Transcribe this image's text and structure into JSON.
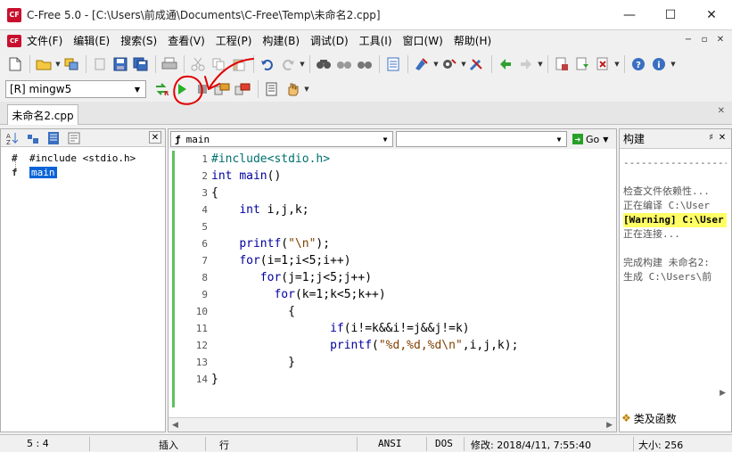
{
  "window": {
    "title": "C-Free 5.0 - [C:\\Users\\前成通\\Documents\\C-Free\\Temp\\未命名2.cpp]",
    "app_icon_text": "CF",
    "minimize": "—",
    "maximize": "☐",
    "close": "✕"
  },
  "menu": {
    "items": [
      "文件(F)",
      "编辑(E)",
      "搜索(S)",
      "查看(V)",
      "工程(P)",
      "构建(B)",
      "调试(D)",
      "工具(I)",
      "窗口(W)",
      "帮助(H)"
    ],
    "right_buttons": [
      "−",
      "▫",
      "✕"
    ]
  },
  "toolbar": {
    "compiler": "[R] mingw5"
  },
  "tabs": {
    "file_tab": "未命名2.cpp",
    "close": "✕"
  },
  "left_panel": {
    "close": "✕",
    "tree": [
      {
        "icon": "#",
        "label": "#include <stdio.h>"
      },
      {
        "icon": "f",
        "label": "main"
      }
    ]
  },
  "editor": {
    "function_combo": "main",
    "go_label": "Go",
    "lines": [
      {
        "n": "1",
        "text": "#include<stdio.h>"
      },
      {
        "n": "2",
        "text": "int main()"
      },
      {
        "n": "3",
        "text": "{"
      },
      {
        "n": "4",
        "text": "    int i,j,k;"
      },
      {
        "n": "5",
        "text": ""
      },
      {
        "n": "6",
        "text": "    printf(\"\\n\");"
      },
      {
        "n": "7",
        "text": "    for(i=1;i<5;i++)"
      },
      {
        "n": "8",
        "text": "       for(j=1;j<5;j++)"
      },
      {
        "n": "9",
        "text": "         for(k=1;k<5;k++)"
      },
      {
        "n": "10",
        "text": "           {"
      },
      {
        "n": "11",
        "text": "                 if(i!=k&&i!=j&&j!=k)"
      },
      {
        "n": "12",
        "text": "                 printf(\"%d,%d,%d\\n\",i,j,k);"
      },
      {
        "n": "13",
        "text": "           }"
      },
      {
        "n": "14",
        "text": "}"
      }
    ]
  },
  "build_panel": {
    "title": "构建",
    "pin": "♯",
    "close": "✕",
    "lines": [
      {
        "text": "---------------------",
        "warn": false
      },
      {
        "text": "",
        "warn": false
      },
      {
        "text": "检查文件依赖性...",
        "warn": false
      },
      {
        "text": "正在编译 C:\\User",
        "warn": false
      },
      {
        "text": "[Warning] C:\\User",
        "warn": true
      },
      {
        "text": "正在连接...",
        "warn": false
      },
      {
        "text": "",
        "warn": false
      },
      {
        "text": "完成构建 未命名2:",
        "warn": false
      },
      {
        "text": "生成 C:\\Users\\前",
        "warn": false
      }
    ],
    "bottom_tab": "类及函数"
  },
  "status": {
    "position": "5 :   4",
    "insert": "插入",
    "line_mode": "行",
    "encoding": "ANSI",
    "eol": "DOS",
    "modified": "修改: 2018/4/11, 7:55:40",
    "size": "大小: 256"
  },
  "colors": {
    "annotation": "#e00000",
    "keyword": "#0000a0",
    "string": "#804000",
    "warning_bg": "#ffff66",
    "selection": "#0a64d8"
  }
}
